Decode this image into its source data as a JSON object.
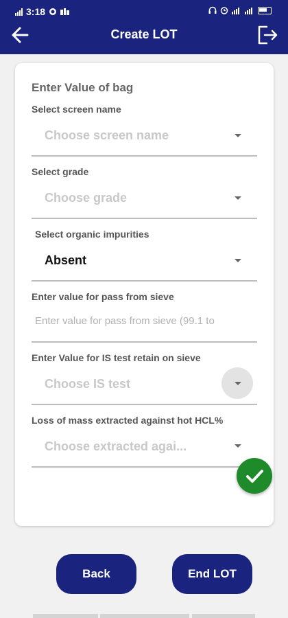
{
  "status_bar": {
    "time": "3:18",
    "battery_label": "85"
  },
  "header": {
    "title": "Create LOT"
  },
  "form": {
    "title": "Enter Value of bag",
    "fields": [
      {
        "label": "Select screen name",
        "value": "Choose screen name"
      },
      {
        "label": "Select grade",
        "value": "Choose grade"
      },
      {
        "label": "Select organic impurities",
        "value": "Absent"
      },
      {
        "label": "Enter value for pass from sieve",
        "placeholder": "Enter value for pass from sieve (99.1 to"
      },
      {
        "label": "Enter Value for IS test retain on sieve",
        "value": "Choose IS test"
      },
      {
        "label": "Loss of mass extracted against hot HCL%",
        "value": "Choose extracted agai..."
      }
    ]
  },
  "buttons": {
    "back_label": "Back",
    "end_label": "End LOT"
  },
  "colors": {
    "primary": "#1a237e",
    "success": "#1e8a2a"
  },
  "icons": {
    "back": "arrow-left-icon",
    "logout": "logout-icon",
    "confirm": "checkmark-icon"
  }
}
